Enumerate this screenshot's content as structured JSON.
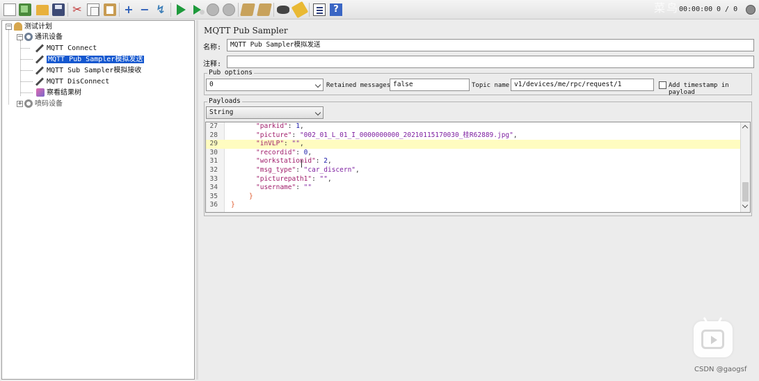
{
  "toolbar": {
    "icons": [
      "new-icon",
      "templates-icon",
      "open-icon",
      "save-icon",
      "cut-icon",
      "copy-icon",
      "paste-icon",
      "add-icon",
      "remove-icon",
      "toggle-icon",
      "start-icon",
      "start-no-timers-icon",
      "stop-icon",
      "shutdown-icon",
      "clear-icon",
      "clear-all-icon",
      "search-icon",
      "reset-search-icon",
      "function-helper-icon",
      "help-icon"
    ],
    "add_glyph": "+",
    "remove_glyph": "−",
    "toggle_glyph": "↯",
    "cut_glyph": "✂",
    "help_glyph": "?"
  },
  "status": {
    "timer": "00:00:00",
    "counts": "0 / 0"
  },
  "watermark_top": "菜鸟",
  "tree": {
    "items": [
      {
        "label": "测试计划",
        "icon": "test-plan-icon"
      },
      {
        "label": "通讯设备",
        "icon": "thread-group-icon"
      },
      {
        "label": "MQTT Connect",
        "icon": "sampler-icon"
      },
      {
        "label": "MQTT Pub Sampler模拟发送",
        "icon": "sampler-icon",
        "selected": true
      },
      {
        "label": "MQTT Sub Sampler模拟接收",
        "icon": "sampler-icon"
      },
      {
        "label": "MQTT DisConnect",
        "icon": "sampler-icon"
      },
      {
        "label": "察看结果树",
        "icon": "listener-icon"
      },
      {
        "label": "喷码设备",
        "icon": "thread-group-icon"
      }
    ]
  },
  "form": {
    "title": "MQTT Pub Sampler",
    "name_label": "名称:",
    "name_value": "MQTT Pub Sampler模拟发送",
    "comment_label": "注释:",
    "comment_value": "",
    "pub_options_legend": "Pub options",
    "qos_value": "0",
    "retained_label": "Retained messages:",
    "retained_value": "false",
    "topic_label": "Topic name:",
    "topic_value": "v1/devices/me/rpc/request/1",
    "timestamp_label": "Add timestamp in payload",
    "payloads_legend": "Payloads",
    "payload_type": "String"
  },
  "editor": {
    "lines": [
      {
        "num": "27",
        "key": "\"parkid\"",
        "sep": ": ",
        "val": "1",
        "valtype": "n",
        "tail": ","
      },
      {
        "num": "28",
        "key": "\"picture\"",
        "sep": ": ",
        "val": "\"002_01_L_01_I_0000000000_20210115170030_桂R62889.jpg\"",
        "valtype": "s",
        "tail": ","
      },
      {
        "num": "29",
        "key": "\"inVLP\"",
        "sep": ": ",
        "val": "\"\"",
        "valtype": "s",
        "tail": ",",
        "highlight": true
      },
      {
        "num": "30",
        "key": "\"recordid\"",
        "sep": ": ",
        "val": "0",
        "valtype": "n",
        "tail": ","
      },
      {
        "num": "31",
        "key": "\"workstationid\"",
        "sep": ": ",
        "val": "2",
        "valtype": "n",
        "tail": ","
      },
      {
        "num": "32",
        "key": "\"msg_type\"",
        "sep": ": ",
        "val": "\"car_discern\"",
        "valtype": "s",
        "tail": ","
      },
      {
        "num": "33",
        "key": "\"picturepath1\"",
        "sep": ": ",
        "val": "\"\"",
        "valtype": "s",
        "tail": ","
      },
      {
        "num": "34",
        "key": "\"username\"",
        "sep": ": ",
        "val": "\"\"",
        "valtype": "s",
        "tail": ""
      },
      {
        "num": "35",
        "brace": "}"
      },
      {
        "num": "36",
        "brace": "}"
      }
    ]
  },
  "credit": "CSDN @gaogsf"
}
